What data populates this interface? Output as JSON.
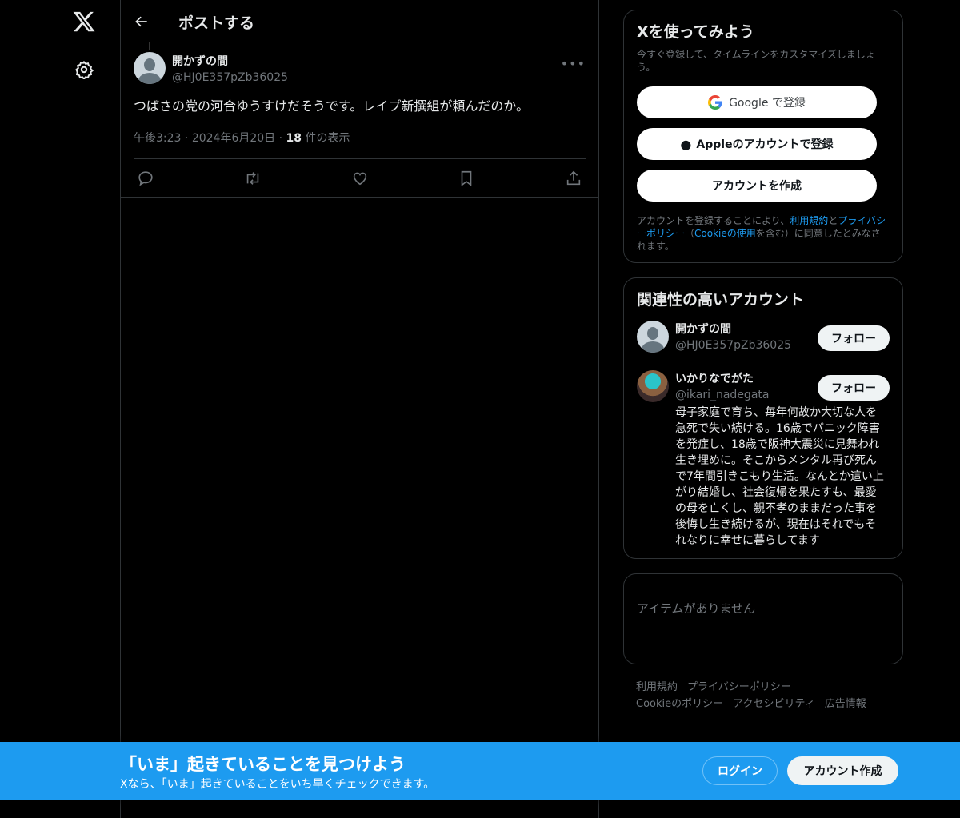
{
  "nav": {
    "logo": "x-logo",
    "settings": "gear-icon"
  },
  "header": {
    "title": "ポストする"
  },
  "tweet": {
    "name": "開かずの間",
    "handle": "@HJ0E357pZb36025",
    "text": "つばさの党の河合ゆうすけだそうです。レイプ新撰組が頼んだのか。",
    "time": "午後3:23",
    "date": "2024年6月20日",
    "views": "18",
    "views_label": "件の表示",
    "sep": "·"
  },
  "signup": {
    "title": "Xを使ってみよう",
    "subtitle": "今すぐ登録して、タイムラインをカスタマイズしましょう。",
    "google": "Google で登録",
    "apple": "Appleのアカウントで登録",
    "create": "アカウントを作成",
    "legal_1": "アカウントを登録することにより、",
    "terms": "利用規約",
    "and": "と",
    "privacy": "プライバシーポリシー",
    "paren_open": "（",
    "cookie": "Cookieの使用",
    "legal_2": "を含む）に同意したとみなされます。"
  },
  "related": {
    "title": "関連性の高いアカウント",
    "accounts": [
      {
        "name": "開かずの間",
        "handle": "@HJ0E357pZb36025",
        "follow": "フォロー"
      },
      {
        "name": "いかりなでがた",
        "handle": "@ikari_nadegata",
        "follow": "フォロー",
        "bio": "母子家庭で育ち、毎年何故か大切な人を急死で失い続ける。16歳でパニック障害を発症し、18歳で阪神大震災に見舞われ生き埋めに。そこからメンタル再び死んで7年間引きこもり生活。なんとか這い上がり結婚し、社会復帰を果たすも、最愛の母を亡くし、親不孝のままだった事を後悔し生き続けるが、現在はそれでもそれなりに幸せに暮らしてます"
      }
    ]
  },
  "trends": {
    "empty": "アイテムがありません"
  },
  "footer": {
    "links": [
      "利用規約",
      "プライバシーポリシー",
      "Cookieのポリシー",
      "アクセシビリティ",
      "広告情報"
    ]
  },
  "banner": {
    "title": "「いま」起きていることを見つけよう",
    "subtitle": "Xなら、「いま」起きていることをいち早くチェックできます。",
    "login": "ログイン",
    "signup": "アカウント作成",
    "color": "#1d9bf0"
  }
}
